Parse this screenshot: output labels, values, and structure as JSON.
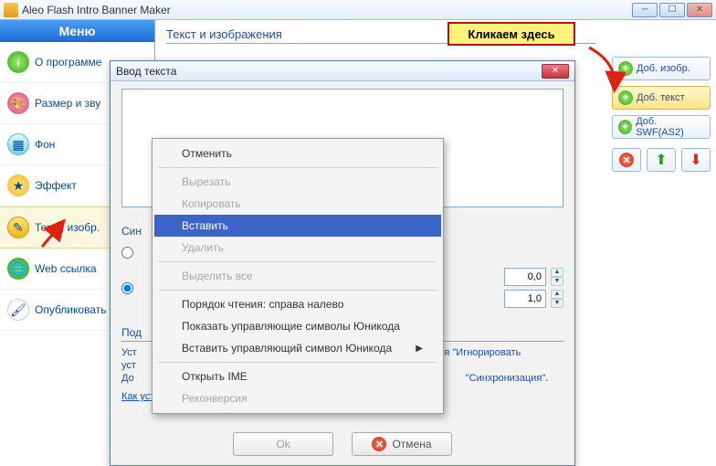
{
  "title": "Aleo Flash Intro Banner Maker",
  "sidebar": {
    "header": "Меню",
    "items": [
      {
        "label": "О программе"
      },
      {
        "label": "Размер и зву"
      },
      {
        "label": "Фон"
      },
      {
        "label": "Эффект"
      },
      {
        "label": "Текст, изобр."
      },
      {
        "label": "Web ссылка"
      },
      {
        "label": "Опубликовать"
      }
    ]
  },
  "content": {
    "section_title": "Текст и изображения"
  },
  "right": {
    "add_image": "Доб. изобр.",
    "add_text": "Доб. текст",
    "add_swf": "Доб. SWF(AS2)"
  },
  "callout": "Кликаем здесь",
  "dialog": {
    "title": "Ввод текста",
    "text_value": "",
    "sync_label": "Син",
    "num1": "0,0",
    "num2": "1,0",
    "hint_title": "Под",
    "hint_line1a": "Уст",
    "hint_line1b": "я опция \"Игнорировать",
    "hint_line2": "уст",
    "hint_line3a": "До",
    "hint_line3b": "\"Синхронизация\".",
    "link": "Как установить параметры синхронизации?",
    "ok": "Ok",
    "cancel": "Отмена"
  },
  "context": {
    "undo": "Отменить",
    "cut": "Вырезать",
    "copy": "Копировать",
    "paste": "Вставить",
    "delete": "Удалить",
    "selectall": "Выделить все",
    "rtl": "Порядок чтения: справа налево",
    "show_unicode": "Показать управляющие символы Юникода",
    "insert_unicode": "Вставить управляющий символ Юникода",
    "open_ime": "Открыть IME",
    "reconvert": "Реконверсия"
  }
}
